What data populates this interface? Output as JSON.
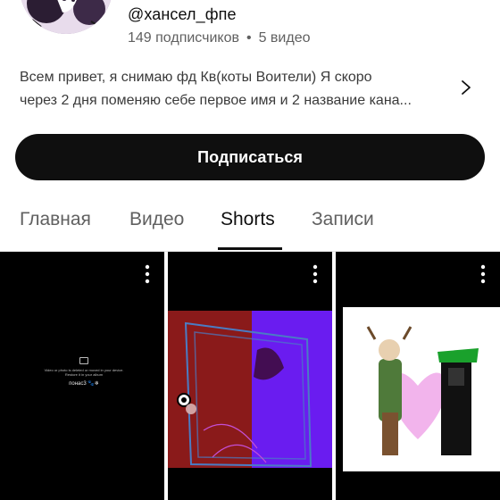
{
  "channel": {
    "handle": "@хансел_фпе",
    "subscribers": "149 подписчиков",
    "separator": "•",
    "videos": "5 видео",
    "description_line1": "Всем привет, я снимаю фд Кв(коты Воители) Я скоро",
    "description_line2": "через 2 дня поменяю себе первое имя и 2 название кана..."
  },
  "subscribe_label": "Подписаться",
  "tabs": [
    {
      "label": "Главная",
      "active": false
    },
    {
      "label": "Видео",
      "active": false
    },
    {
      "label": "Shorts",
      "active": true
    },
    {
      "label": "Записи",
      "active": false
    }
  ],
  "shorts": [
    {
      "kind": "deleted",
      "notice": "Video or photo is deleted or moved in your device. Restore it in your album",
      "signature": "понас3 🐾❄"
    },
    {
      "kind": "drawing-red-purple"
    },
    {
      "kind": "drawing-characters"
    }
  ],
  "icons": {
    "chevron": "chevron-right-icon",
    "menu": "more-vert-icon"
  },
  "colors": {
    "subscribe_bg": "#0f0f0f",
    "tab_active": "#0f0f0f",
    "tab_inactive": "#606060"
  }
}
